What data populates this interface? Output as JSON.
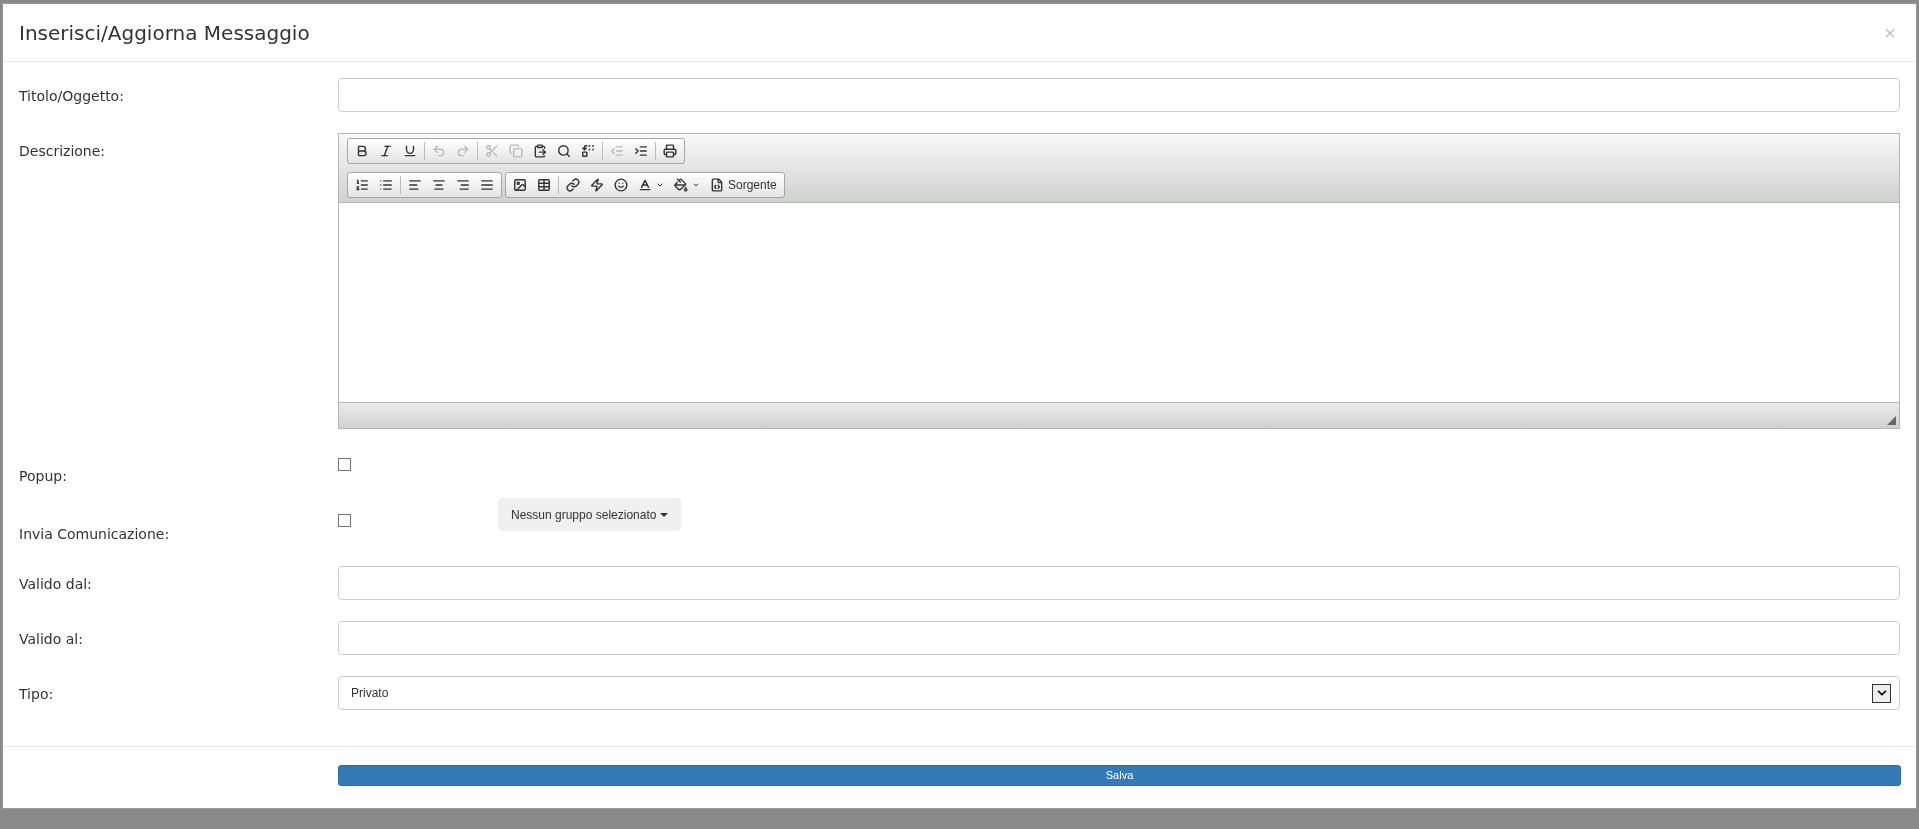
{
  "dialog": {
    "title": "Inserisci/Aggiorna Messaggio",
    "close": "×"
  },
  "fields": [
    {
      "kind": "text",
      "label": "Titolo/Oggetto:"
    },
    {
      "kind": "editor",
      "label": "Descrizione:",
      "toolbar": [
        [
          [
            {
              "kind": "bold",
              "disabled": false
            },
            {
              "kind": "italic",
              "disabled": false
            },
            {
              "kind": "underline",
              "disabled": false
            }
          ],
          [
            {
              "kind": "undo",
              "disabled": true
            },
            {
              "kind": "redo",
              "disabled": true
            }
          ],
          [
            {
              "kind": "cut",
              "disabled": true
            },
            {
              "kind": "copy",
              "disabled": true
            },
            {
              "kind": "paste",
              "disabled": false
            },
            {
              "kind": "find",
              "disabled": false
            },
            {
              "kind": "replace",
              "disabled": false
            }
          ],
          [
            {
              "kind": "outdent",
              "disabled": true
            },
            {
              "kind": "indent",
              "disabled": false
            }
          ],
          [
            {
              "kind": "print",
              "disabled": false
            }
          ]
        ],
        [
          [
            {
              "kind": "numbered-list",
              "disabled": false
            },
            {
              "kind": "bulleted-list",
              "disabled": false
            }
          ],
          [
            {
              "kind": "align-left",
              "disabled": false
            },
            {
              "kind": "align-center",
              "disabled": false
            },
            {
              "kind": "align-right",
              "disabled": false
            },
            {
              "kind": "justify",
              "disabled": false
            }
          ]
        ],
        [
          [
            {
              "kind": "image",
              "disabled": false
            },
            {
              "kind": "table",
              "disabled": false
            }
          ],
          [
            {
              "kind": "link",
              "disabled": false
            },
            {
              "kind": "flash",
              "disabled": false
            },
            {
              "kind": "smiley",
              "disabled": false
            },
            {
              "kind": "text-color",
              "disabled": false
            },
            {
              "kind": "background-color",
              "disabled": false
            },
            {
              "kind": "source",
              "label": "Sorgente",
              "disabled": false
            }
          ]
        ]
      ]
    },
    {
      "kind": "checkbox",
      "label": "Popup:",
      "checked": false
    },
    {
      "kind": "checkbox-dropdown",
      "label": "Invia Comunicazione:",
      "checked": false,
      "dropdown": "Nessun gruppo selezionato"
    },
    {
      "kind": "text",
      "label": "Valido dal:"
    },
    {
      "kind": "text",
      "label": "Valido al:"
    },
    {
      "kind": "select",
      "label": "Tipo:",
      "value": "Privato"
    }
  ],
  "save_button": "Salva"
}
